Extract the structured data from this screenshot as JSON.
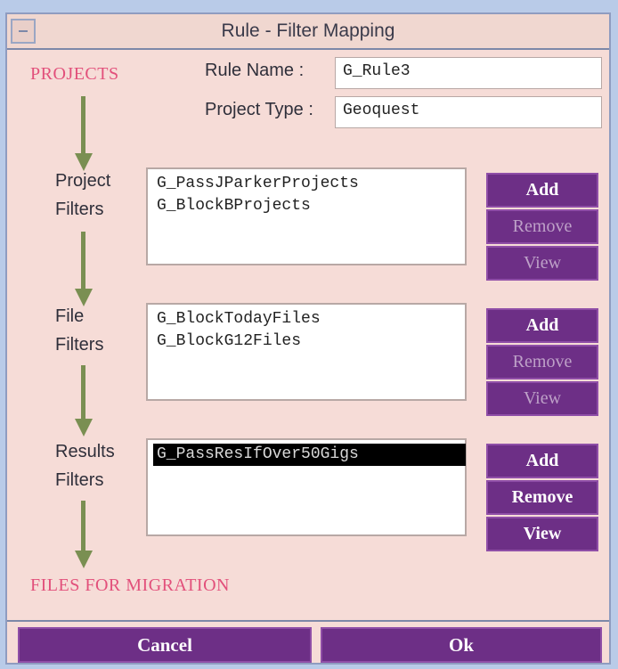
{
  "window": {
    "title": "Rule - Filter Mapping"
  },
  "flow": {
    "projects": "PROJECTS",
    "files_for_migration": "FILES FOR MIGRATION"
  },
  "form": {
    "rule_name_label": "Rule Name :",
    "rule_name_value": "G_Rule3",
    "project_type_label": "Project Type :",
    "project_type_value": "Geoquest"
  },
  "sections": [
    {
      "label_line1": "Project",
      "label_line2": "Filters",
      "items": [
        "G_PassJParkerProjects",
        "G_BlockBProjects"
      ],
      "buttons": {
        "add": "Add",
        "remove": "Remove",
        "view": "View"
      }
    },
    {
      "label_line1": "File",
      "label_line2": "Filters",
      "items": [
        "G_BlockTodayFiles",
        "G_BlockG12Files"
      ],
      "buttons": {
        "add": "Add",
        "remove": "Remove",
        "view": "View"
      }
    },
    {
      "label_line1": "Results",
      "label_line2": "Filters",
      "items": [
        "G_PassResIfOver50Gigs"
      ],
      "buttons": {
        "add": "Add",
        "remove": "Remove",
        "view": "View"
      }
    }
  ],
  "footer": {
    "cancel": "Cancel",
    "ok": "Ok"
  },
  "colors": {
    "background": "#f6dcd7",
    "accent_purple": "#6d2f86",
    "flow_pink": "#e2507b",
    "arrow_green": "#7a8f52"
  }
}
